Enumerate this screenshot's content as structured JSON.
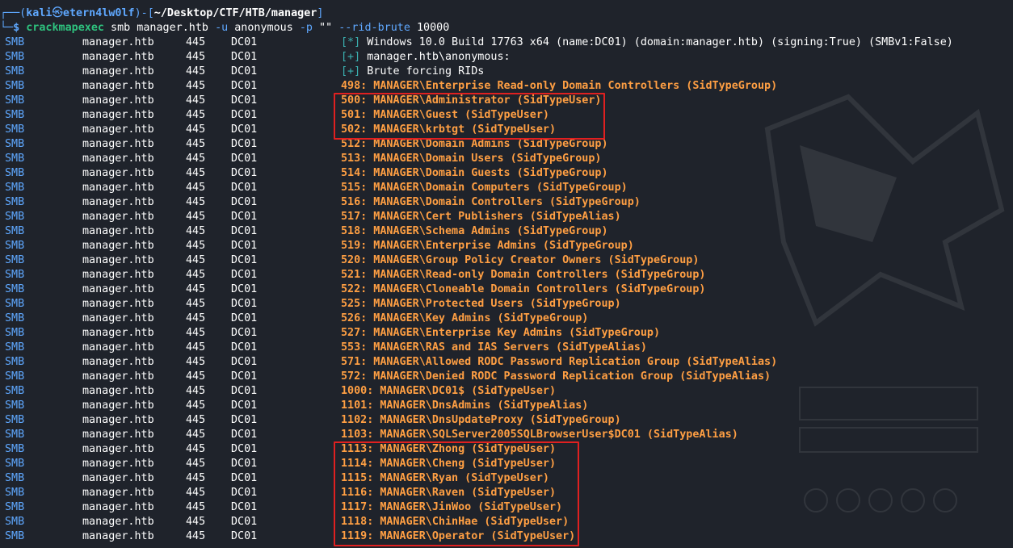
{
  "prompt": {
    "frame_top": "┌──(",
    "user": "kali",
    "at": "㉿",
    "host": "etern4lw0lf",
    "sep": ")-[",
    "path": "~/Desktop/CTF/HTB/manager",
    "close": "]",
    "frame_bottom": "└─",
    "dollar": "$",
    "cmd_name": "crackmapexec",
    "cmd_args_1": " smb manager.htb ",
    "flag_u": "-u",
    "arg_anon": " anonymous ",
    "flag_p": "-p",
    "arg_pw": " \"\" ",
    "flag_rid": "--rid-brute",
    "arg_rid": " 10000"
  },
  "columns": {
    "protocol": "SMB",
    "host": "manager.htb",
    "port": "445",
    "name": "DC01"
  },
  "info_lines": [
    {
      "marker": "[*]",
      "text": " Windows 10.0 Build 17763 x64 (name:DC01) (domain:manager.htb) (signing:True) (SMBv1:False)"
    },
    {
      "marker": "[+]",
      "text": " manager.htb\\anonymous:"
    },
    {
      "marker": "[+]",
      "text": " Brute forcing RIDs"
    }
  ],
  "rid_lines": [
    "498: MANAGER\\Enterprise Read-only Domain Controllers (SidTypeGroup)",
    "500: MANAGER\\Administrator (SidTypeUser)",
    "501: MANAGER\\Guest (SidTypeUser)",
    "502: MANAGER\\krbtgt (SidTypeUser)",
    "512: MANAGER\\Domain Admins (SidTypeGroup)",
    "513: MANAGER\\Domain Users (SidTypeGroup)",
    "514: MANAGER\\Domain Guests (SidTypeGroup)",
    "515: MANAGER\\Domain Computers (SidTypeGroup)",
    "516: MANAGER\\Domain Controllers (SidTypeGroup)",
    "517: MANAGER\\Cert Publishers (SidTypeAlias)",
    "518: MANAGER\\Schema Admins (SidTypeGroup)",
    "519: MANAGER\\Enterprise Admins (SidTypeGroup)",
    "520: MANAGER\\Group Policy Creator Owners (SidTypeGroup)",
    "521: MANAGER\\Read-only Domain Controllers (SidTypeGroup)",
    "522: MANAGER\\Cloneable Domain Controllers (SidTypeGroup)",
    "525: MANAGER\\Protected Users (SidTypeGroup)",
    "526: MANAGER\\Key Admins (SidTypeGroup)",
    "527: MANAGER\\Enterprise Key Admins (SidTypeGroup)",
    "553: MANAGER\\RAS and IAS Servers (SidTypeAlias)",
    "571: MANAGER\\Allowed RODC Password Replication Group (SidTypeAlias)",
    "572: MANAGER\\Denied RODC Password Replication Group (SidTypeAlias)",
    "1000: MANAGER\\DC01$ (SidTypeUser)",
    "1101: MANAGER\\DnsAdmins (SidTypeAlias)",
    "1102: MANAGER\\DnsUpdateProxy (SidTypeGroup)",
    "1103: MANAGER\\SQLServer2005SQLBrowserUser$DC01 (SidTypeAlias)",
    "1113: MANAGER\\Zhong (SidTypeUser)",
    "1114: MANAGER\\Cheng (SidTypeUser)",
    "1115: MANAGER\\Ryan (SidTypeUser)",
    "1116: MANAGER\\Raven (SidTypeUser)",
    "1117: MANAGER\\JinWoo (SidTypeUser)",
    "1118: MANAGER\\ChinHae (SidTypeUser)",
    "1119: MANAGER\\Operator (SidTypeUser)"
  ],
  "highlight_color": "#e02020",
  "accent_colors": {
    "protocol": "#5fa8ff",
    "rid_text": "#ff9f43",
    "prompt_path": "#ffffff",
    "command": "#2ec27e"
  }
}
